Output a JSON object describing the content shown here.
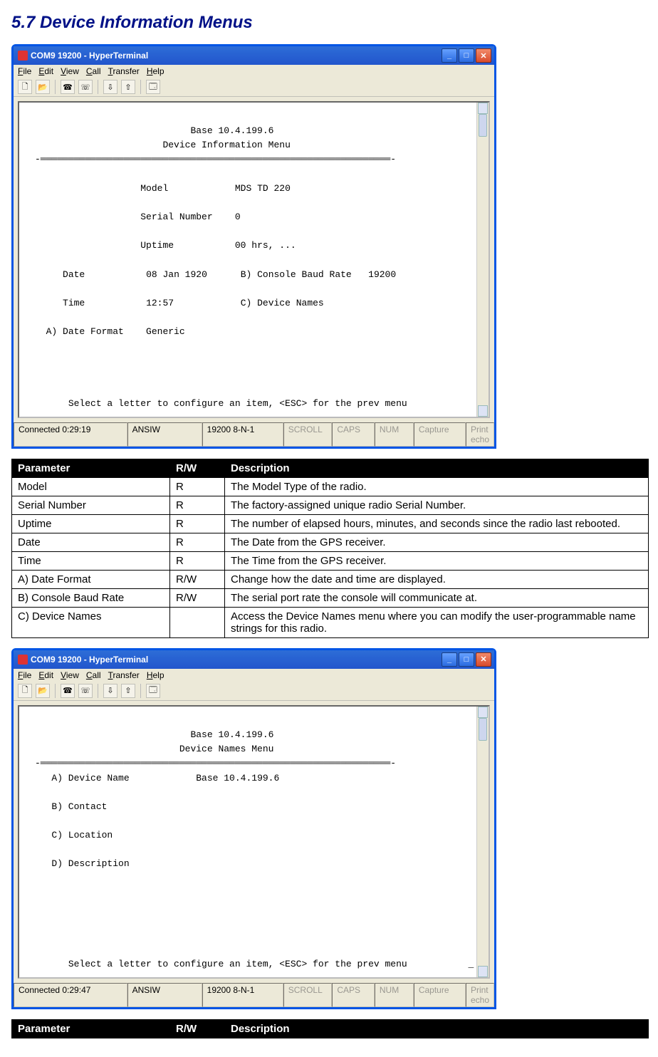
{
  "section_title": "5.7 Device Information Menus",
  "hyperterminal": {
    "title": "COM9 19200 - HyperTerminal",
    "menus": {
      "file": "File",
      "edit": "Edit",
      "view": "View",
      "call": "Call",
      "transfer": "Transfer",
      "help": "Help"
    },
    "status": {
      "conn1": "Connected 0:29:19",
      "conn2": "Connected 0:29:47",
      "emul": "ANSIW",
      "port": "19200 8-N-1",
      "scroll": "SCROLL",
      "caps": "CAPS",
      "num": "NUM",
      "capture": "Capture",
      "echo": "Print echo"
    }
  },
  "screen1": {
    "hdr1": "Base 10.4.199.6",
    "hdr2": "Device Information Menu",
    "model_lbl": "Model",
    "model_val": "MDS TD 220",
    "serial_lbl": "Serial Number",
    "serial_val": "0",
    "uptime_lbl": "Uptime",
    "uptime_val": "00 hrs, ...",
    "date_lbl": "Date",
    "date_val": "08 Jan 1920",
    "time_lbl": "Time",
    "time_val": "12:57",
    "a_lbl": "A) Date Format",
    "a_val": "Generic",
    "b_lbl": "B) Console Baud Rate",
    "b_val": "19200",
    "c_lbl": "C) Device Names",
    "footer": "Select a letter to configure an item, <ESC> for the prev menu"
  },
  "screen2": {
    "hdr1": "Base 10.4.199.6",
    "hdr2": "Device Names Menu",
    "a_lbl": "A) Device Name",
    "a_val": "Base 10.4.199.6",
    "b_lbl": "B) Contact",
    "c_lbl": "C) Location",
    "d_lbl": "D) Description",
    "footer": "Select a letter to configure an item, <ESC> for the prev menu"
  },
  "table_hdr": {
    "c1": "Parameter",
    "c2": "R/W",
    "c3": "Description"
  },
  "table1": [
    {
      "p": "Model",
      "rw": "R",
      "d": "The Model Type of the radio."
    },
    {
      "p": "Serial Number",
      "rw": "R",
      "d": "The factory-assigned unique radio Serial Number."
    },
    {
      "p": "Uptime",
      "rw": "R",
      "d": "The number of elapsed hours, minutes, and seconds since the radio last rebooted."
    },
    {
      "p": "Date",
      "rw": "R",
      "d": "The Date from the GPS receiver."
    },
    {
      "p": "Time",
      "rw": "R",
      "d": "The Time from the GPS receiver."
    },
    {
      "p": "A) Date Format",
      "rw": "R/W",
      "d": "Change how the date and time are displayed."
    },
    {
      "p": "B) Console Baud Rate",
      "rw": "R/W",
      "d": "The serial port rate the console will communicate at."
    },
    {
      "p": "C) Device Names",
      "rw": "",
      "d": "Access the Device Names menu where you can modify the user-programmable name strings for this radio."
    }
  ]
}
